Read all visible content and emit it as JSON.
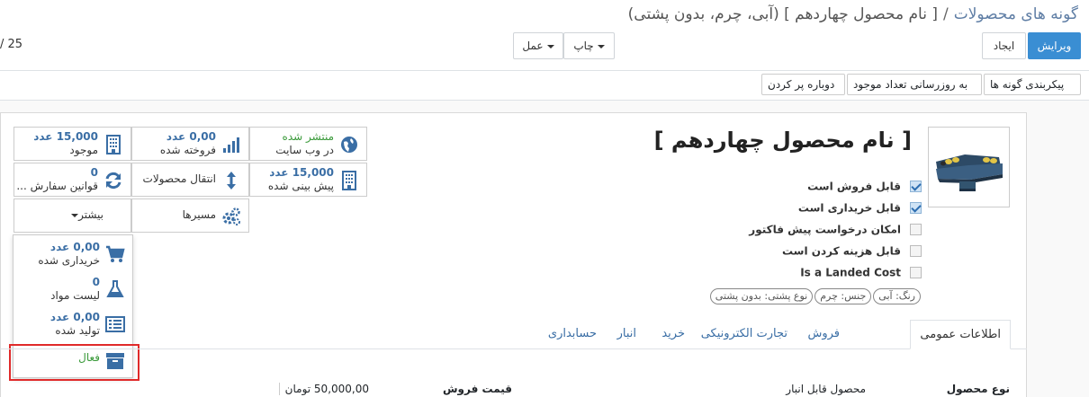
{
  "breadcrumb": {
    "parent": "گونه های محصولات",
    "separator": "/",
    "current": "[ نام محصول چهاردهم ] (آبی، چرم، بدون پشتی)"
  },
  "toolbar": {
    "edit": "ویرایش",
    "create": "ایجاد",
    "print": "چاپ",
    "action": "عمل"
  },
  "pager": {
    "text": "/ 25"
  },
  "statusbar": {
    "configure_variants": "پیکربندی گونه ها",
    "update_qty": "به روزرسانی تعداد موجود",
    "replenish": "دوباره پر کردن"
  },
  "smart_buttons": {
    "published": {
      "value": "منتشر شده",
      "label": "در وب سایت"
    },
    "sold": {
      "value": "0,00 عدد",
      "label": "فروخته شده"
    },
    "on_hand": {
      "value": "15,000 عدد",
      "label": "موجود"
    },
    "forecasted": {
      "value": "15,000 عدد",
      "label": "پیش بینی شده"
    },
    "moves": {
      "label": "انتقال محصولات"
    },
    "reordering": {
      "value": "0",
      "label": "قوانین سفارش ..."
    },
    "routes": {
      "label": "مسیرها"
    },
    "more": {
      "label": "بیشتر"
    }
  },
  "more_menu": {
    "purchased": {
      "value": "0,00 عدد",
      "label": "خریداری شده"
    },
    "bom": {
      "value": "0",
      "label": "لیست مواد"
    },
    "manufactured": {
      "value": "0,00 عدد",
      "label": "تولید شده"
    },
    "active": {
      "label": "فعال"
    }
  },
  "product": {
    "title": "[ نام محصول چهاردهم ]",
    "options": [
      {
        "label": "قابل فروش است",
        "checked": true
      },
      {
        "label": "قابل خریداری است",
        "checked": true
      },
      {
        "label": "امکان درخواست پیش فاکتور",
        "checked": false
      },
      {
        "label": "قابل هزینه کردن است",
        "checked": false
      },
      {
        "label": "Is a Landed Cost",
        "checked": false
      }
    ],
    "tags": [
      "رنگ: آبی",
      "جنس: چرم",
      "نوع پشتی: بدون پشتی"
    ]
  },
  "tabs": [
    "اطلاعات عمومی",
    "فروش",
    "تجارت الکترونیکی",
    "خرید",
    "انبار",
    "حسابداری"
  ],
  "fields": {
    "product_type_label": "نوع محصول",
    "product_type_value": "محصول قابل انبار",
    "sale_price_label": "قیمت فروش",
    "sale_price_value": "50,000,00 تومان"
  },
  "colors": {
    "primary": "#3a8ed3",
    "link": "#3a6ea5",
    "published": "#3a9a3a",
    "highlight": "#e02a2a"
  }
}
